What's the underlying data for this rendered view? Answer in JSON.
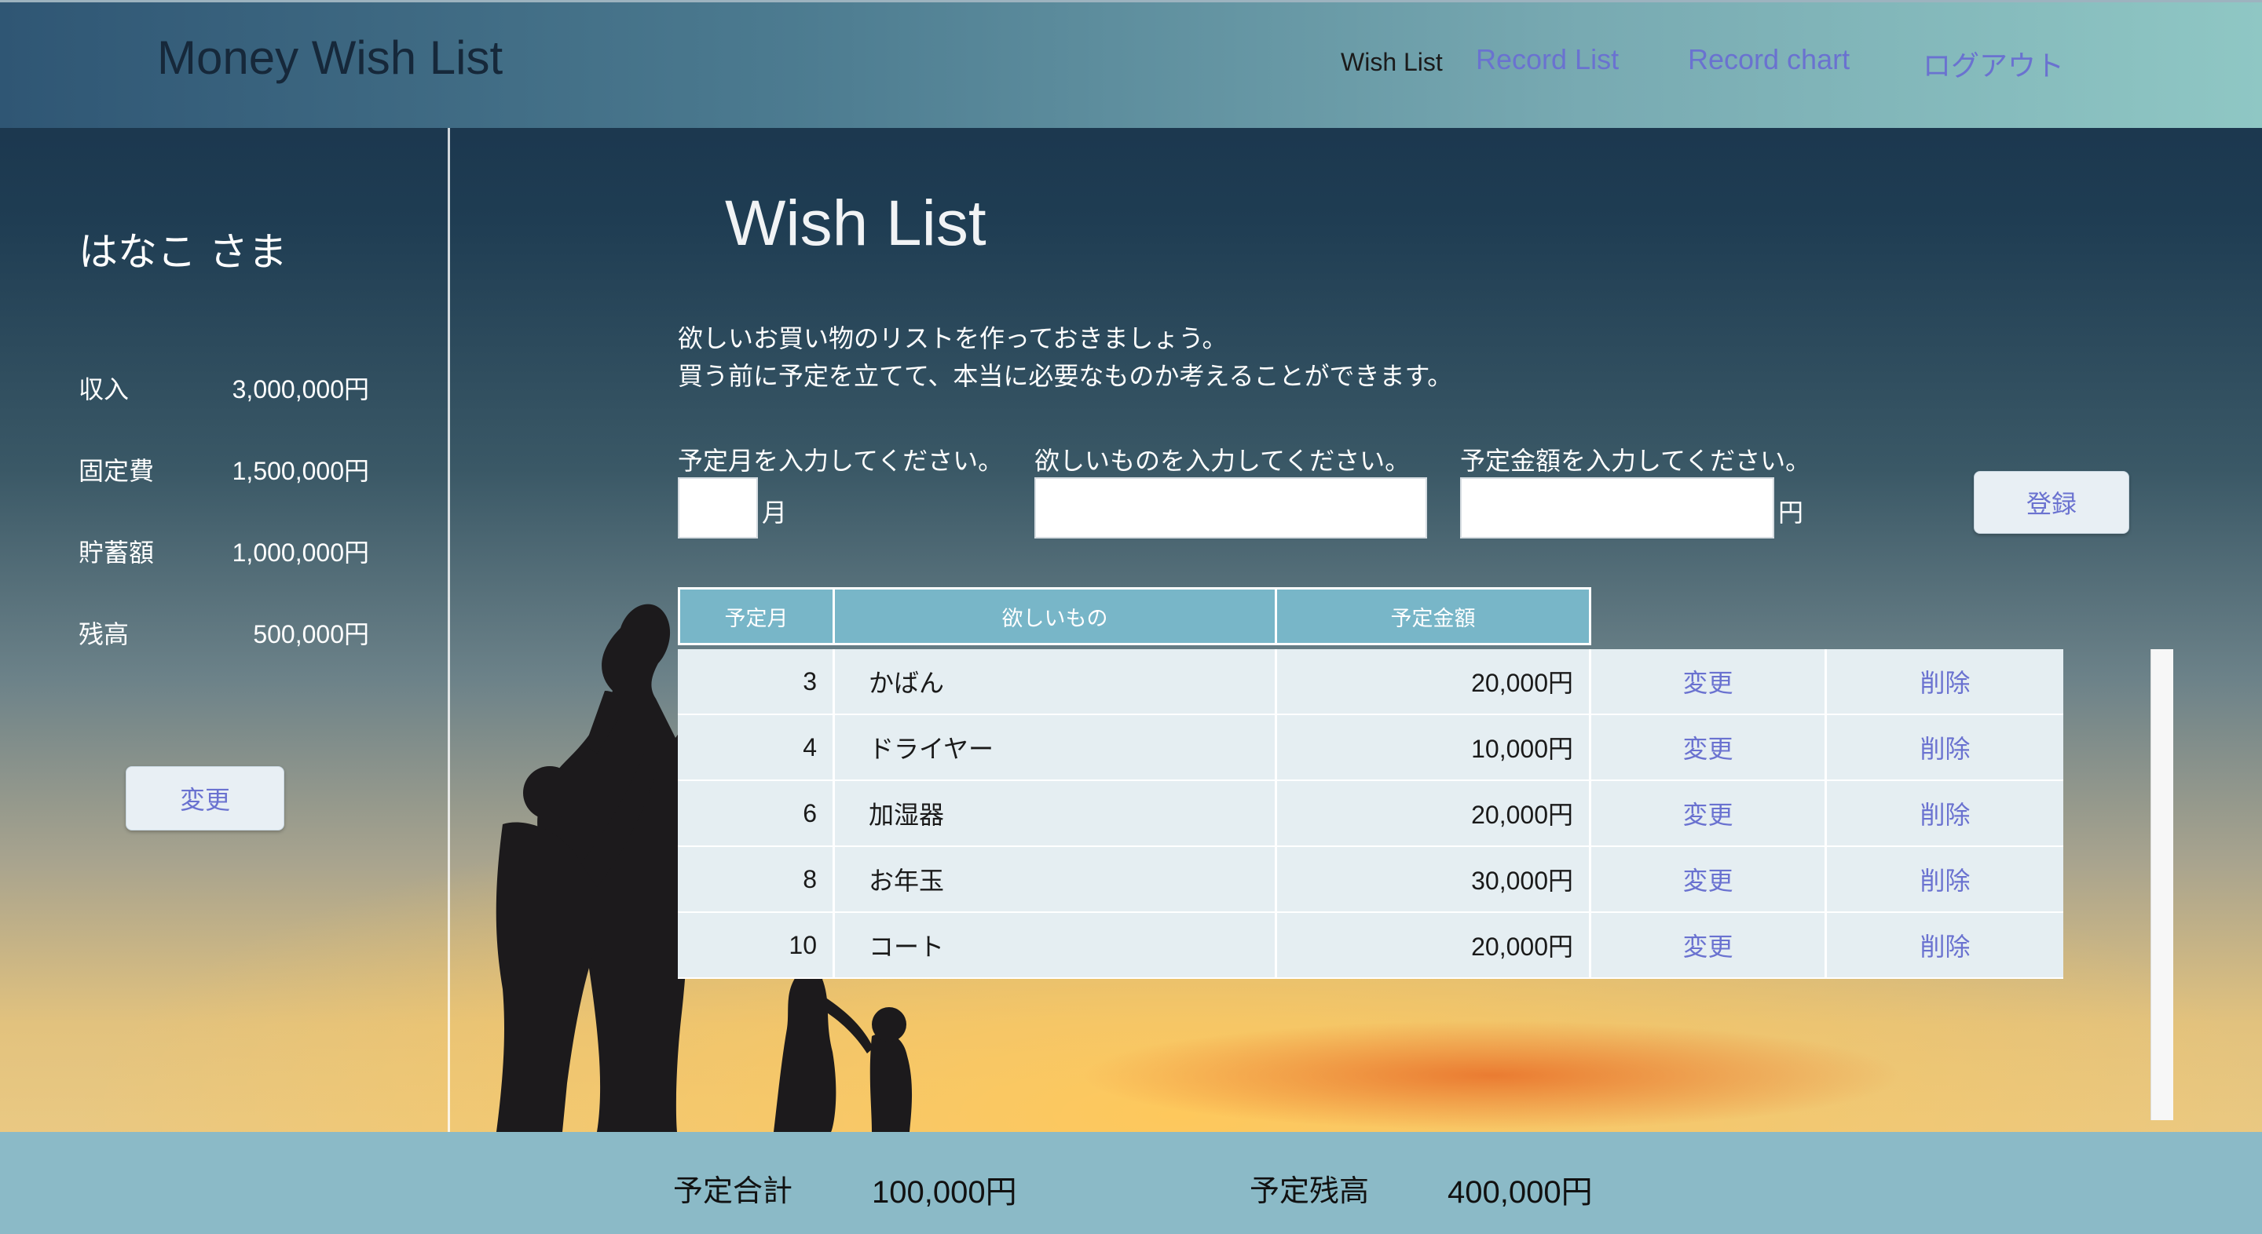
{
  "header": {
    "brand": "Money Wish List",
    "nav": [
      {
        "label": "Wish List",
        "active": true
      },
      {
        "label": "Record List",
        "active": false
      },
      {
        "label": "Record chart",
        "active": false
      },
      {
        "label": "ログアウト",
        "active": false
      }
    ]
  },
  "sidebar": {
    "user_name": "はなこ さま",
    "stats": [
      {
        "label": "収入",
        "value": "3,000,000円"
      },
      {
        "label": "固定費",
        "value": "1,500,000円"
      },
      {
        "label": "貯蓄額",
        "value": "1,000,000円"
      },
      {
        "label": "残高",
        "value": "500,000円"
      }
    ],
    "edit_button": "変更"
  },
  "main": {
    "title": "Wish List",
    "description": [
      "欲しいお買い物のリストを作っておきましょう。",
      "買う前に予定を立てて、本当に必要なものか考えることができます。"
    ],
    "form": {
      "month_label": "予定月を入力してください。",
      "month_unit": "月",
      "month_value": "",
      "item_label": "欲しいものを入力してください。",
      "item_value": "",
      "amount_label": "予定金額を入力してください。",
      "amount_unit": "円",
      "amount_value": "",
      "submit_button": "登録"
    },
    "table": {
      "headers": [
        "予定月",
        "欲しいもの",
        "予定金額"
      ],
      "rows": [
        {
          "month": "3",
          "item": "かばん",
          "amount": "20,000円",
          "edit": "変更",
          "delete": "削除"
        },
        {
          "month": "4",
          "item": "ドライヤー",
          "amount": "10,000円",
          "edit": "変更",
          "delete": "削除"
        },
        {
          "month": "6",
          "item": "加湿器",
          "amount": "20,000円",
          "edit": "変更",
          "delete": "削除"
        },
        {
          "month": "8",
          "item": "お年玉",
          "amount": "30,000円",
          "edit": "変更",
          "delete": "削除"
        },
        {
          "month": "10",
          "item": "コート",
          "amount": "20,000円",
          "edit": "変更",
          "delete": "削除"
        }
      ]
    }
  },
  "footer": {
    "total_label": "予定合計",
    "total_value": "100,000円",
    "remaining_label": "予定残高",
    "remaining_value": "400,000円"
  },
  "colors": {
    "accent_link": "#6a72d0",
    "table_header": "#78b6c8",
    "footer_bg": "#8bbac7"
  }
}
